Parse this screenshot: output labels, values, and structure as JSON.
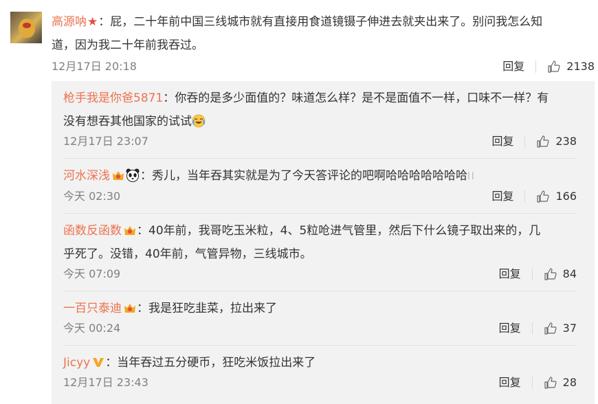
{
  "main_comment": {
    "username": "高源呐",
    "text_line1": "：屁，二十年前中国三线城市就有直接用食道镜镊子伸进去就夹出来了。别问我怎么知",
    "text_line2": "道，因为我二十年前我吞过。",
    "time": "12月17日 20:18",
    "reply_label": "回复",
    "likes": "2138"
  },
  "replies": [
    {
      "username": "枪手我是你爸5871",
      "text_line1": "：你吞的是多少面值的？味道怎么样？是不是面值不一样，口味不一样？有",
      "text_line2": "没有想吞其他国家的试试",
      "time": "12月17日 23:07",
      "reply_label": "回复",
      "likes": "238"
    },
    {
      "username": "河水深浅",
      "text_line1": "：秀儿，当年吞其实就是为了今天答评论的吧啊哈哈哈哈哈哈哈",
      "trailing": "ll",
      "time": "今天 02:30",
      "reply_label": "回复",
      "likes": "166"
    },
    {
      "username": "函数反函数",
      "text_line1": "：40年前，我哥吃玉米粒，4、5粒呛进气管里，然后下什么镜子取出来的，几",
      "text_line2": "乎死了。没错，40年前，气管异物，三线城市。",
      "time": "今天 07:09",
      "reply_label": "回复",
      "likes": "84"
    },
    {
      "username": "一百只泰迪",
      "text_line1": "：我是狂吃韭菜，拉出来了",
      "time": "今天 00:24",
      "reply_label": "回复",
      "likes": "37"
    },
    {
      "username": "Jicyy",
      "text_line1": "：当年吞过五分硬币，狂吃米饭拉出来了",
      "time": "12月17日 23:43",
      "reply_label": "回复",
      "likes": "28"
    }
  ],
  "colors": {
    "username": "#eb7350",
    "reply_bg": "#f2f2f2",
    "meta_gray": "#808080",
    "star": "#e74c3c",
    "vip_badge": "#f5a623"
  }
}
